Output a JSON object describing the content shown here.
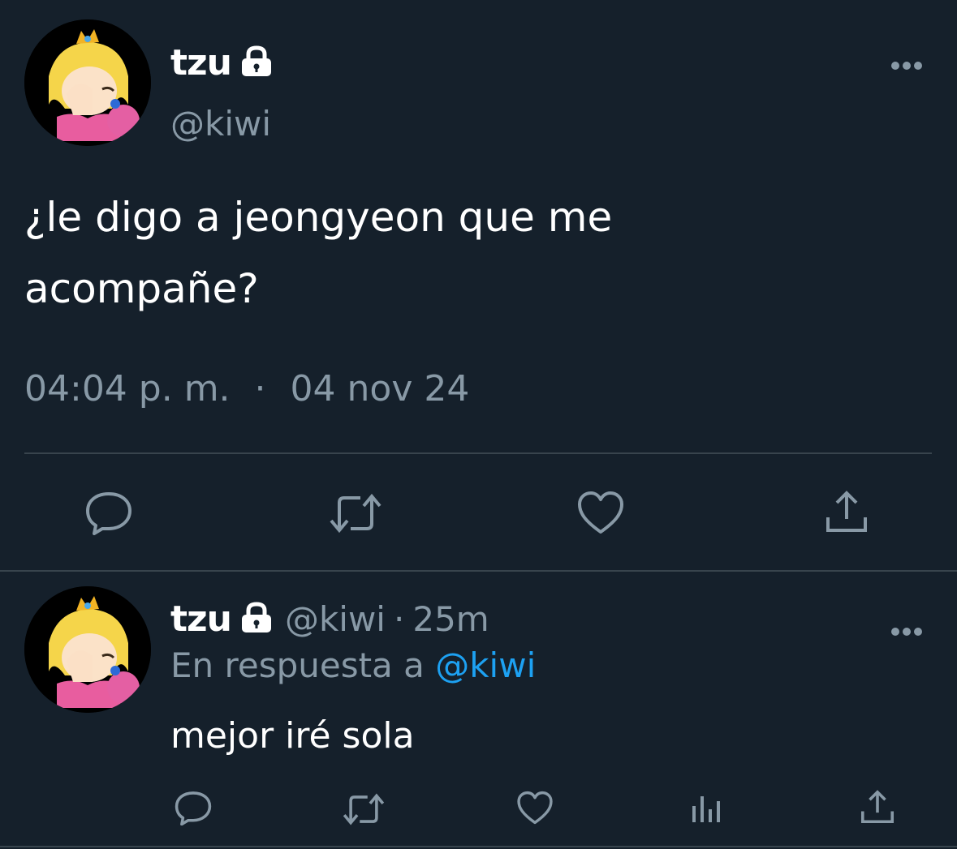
{
  "main_tweet": {
    "display_name": "tzu",
    "handle": "@kiwi",
    "text_line1": "¿le digo a jeongyeon que me",
    "text_line2": "acompañe?",
    "time": "04:04 p. m.",
    "separator": "·",
    "date": "04 nov 24",
    "more_icon": "more-icon"
  },
  "reply_tweet": {
    "display_name": "tzu",
    "handle": "@kiwi",
    "dot": "·",
    "age": "25m",
    "reply_prefix": "En respuesta a",
    "reply_to": "@kiwi",
    "text": "mejor iré sola"
  },
  "colors": {
    "background": "#15202b",
    "secondary_text": "#8899a6",
    "link": "#1da1f2",
    "divider": "#38444d"
  },
  "icons": [
    "lock-icon",
    "reply-icon",
    "retweet-icon",
    "like-icon",
    "share-icon",
    "analytics-icon",
    "more-icon"
  ]
}
